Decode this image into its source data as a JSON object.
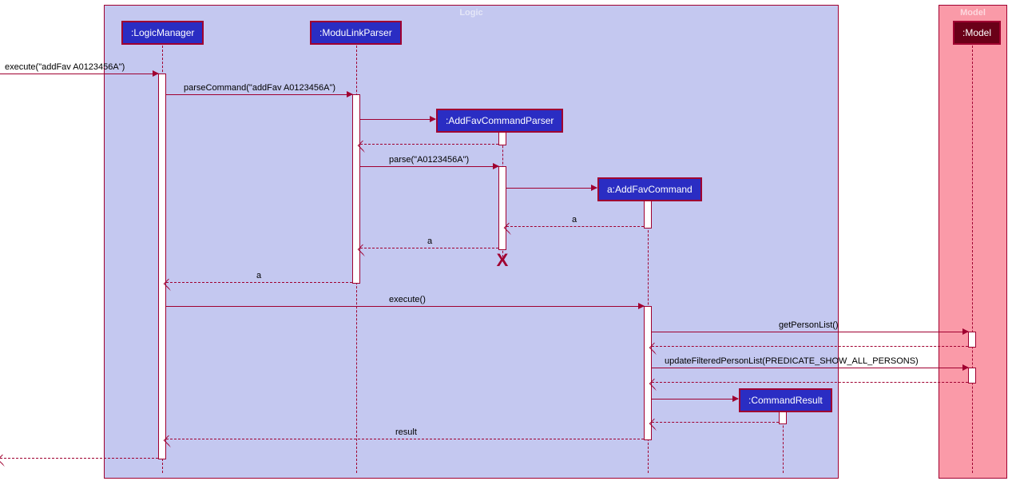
{
  "groups": {
    "logic": {
      "title": "Logic"
    },
    "model": {
      "title": "Model"
    }
  },
  "participants": {
    "logicManager": ":LogicManager",
    "moduLinkParser": ":ModuLinkParser",
    "addFavCommandParser": ":AddFavCommandParser",
    "addFavCommand": "a:AddFavCommand",
    "commandResult": ":CommandResult",
    "model": ":Model"
  },
  "messages": {
    "execute1": "execute(\"addFav A0123456A\")",
    "parseCommand": "parseCommand(\"addFav A0123456A\")",
    "parse": "parse(\"A0123456A\")",
    "a1": "a",
    "a2": "a",
    "a3": "a",
    "execute2": "execute()",
    "getPersonList": "getPersonList()",
    "updateFiltered": "updateFilteredPersonList(PREDICATE_SHOW_ALL_PERSONS)",
    "result": "result"
  }
}
